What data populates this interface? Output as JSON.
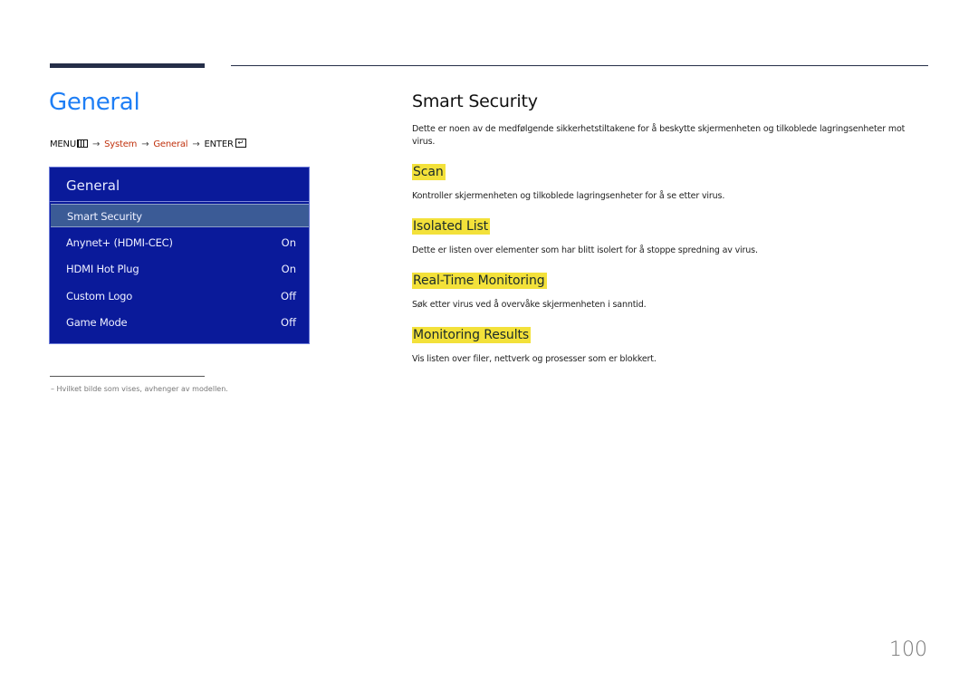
{
  "header": {
    "page_title": "General"
  },
  "breadcrumb": {
    "menu_label": "MENU",
    "menu_icon": "menu-grid-icon",
    "arrow": "→",
    "system_label": "System",
    "general_label": "General",
    "enter_label": "ENTER",
    "enter_icon": "enter-icon",
    "enter_glyph": "↵"
  },
  "menu_panel": {
    "title": "General",
    "items": [
      {
        "label": "Smart Security",
        "value": "",
        "selected": true
      },
      {
        "label": "Anynet+ (HDMI-CEC)",
        "value": "On"
      },
      {
        "label": "HDMI Hot Plug",
        "value": "On"
      },
      {
        "label": "Custom Logo",
        "value": "Off"
      },
      {
        "label": "Game Mode",
        "value": "Off"
      }
    ]
  },
  "footnote": {
    "text": "–   Hvilket bilde som vises, avhenger av modellen."
  },
  "content": {
    "title": "Smart Security",
    "intro": "Dette er noen av de medfølgende sikkerhetstiltakene for å beskytte skjermenheten og tilkoblede lagringsenheter mot virus.",
    "sections": [
      {
        "title": "Scan",
        "description": "Kontroller skjermenheten og tilkoblede lagringsenheter for å se etter virus."
      },
      {
        "title": "Isolated List",
        "description": "Dette er listen over elementer som har blitt isolert for å stoppe spredning av virus."
      },
      {
        "title": "Real-Time Monitoring",
        "description": "Søk etter virus ved å overvåke skjermenheten i sanntid."
      },
      {
        "title": "Monitoring Results",
        "description": "Vis listen over filer, nettverk og prosesser som er blokkert."
      }
    ]
  },
  "page_number": "100",
  "colors": {
    "title_blue": "#1e7ef5",
    "breadcrumb_link": "#c0320e",
    "menu_bg": "#0a1a9a",
    "menu_selected": "#3b5b96",
    "highlight": "#f3e13a",
    "rule": "#252e48"
  }
}
